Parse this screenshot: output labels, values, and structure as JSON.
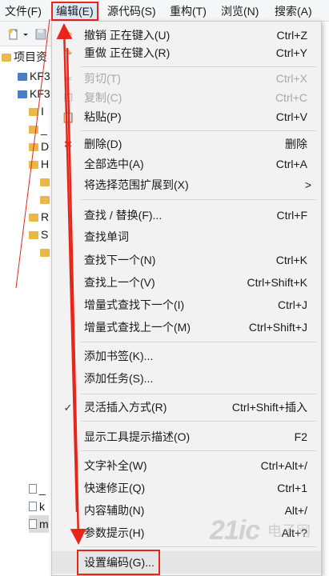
{
  "menubar": {
    "file": "文件(F)",
    "edit": "编辑(E)",
    "source": "源代码(S)",
    "refactor": "重构(T)",
    "navigate": "浏览(N)",
    "search": "搜索(A)"
  },
  "tree": {
    "header": "项目资",
    "rows": [
      "KF3",
      "KF3",
      "I",
      "_",
      "D",
      "H",
      "",
      "",
      "R",
      "S",
      "",
      "_",
      "k",
      "m"
    ]
  },
  "menu": {
    "items": [
      {
        "label": "撤销 正在键入(U)",
        "shortcut": "Ctrl+Z",
        "icon": "undo-icon"
      },
      {
        "label": "重做 正在键入(R)",
        "shortcut": "Ctrl+Y",
        "icon": "redo-icon"
      },
      {
        "label": "剪切(T)",
        "shortcut": "Ctrl+X",
        "icon": "cut-icon",
        "disabled": true
      },
      {
        "label": "复制(C)",
        "shortcut": "Ctrl+C",
        "icon": "copy-icon",
        "disabled": true
      },
      {
        "label": "粘贴(P)",
        "shortcut": "Ctrl+V",
        "icon": "paste-icon"
      },
      {
        "label": "删除(D)",
        "shortcut": "删除",
        "icon": "delete-icon"
      },
      {
        "label": "全部选中(A)",
        "shortcut": "Ctrl+A"
      },
      {
        "label": "将选择范围扩展到(X)",
        "shortcut": ">"
      },
      {
        "label": "查找 / 替换(F)...",
        "shortcut": "Ctrl+F"
      },
      {
        "label": "查找单词",
        "shortcut": ""
      },
      {
        "label": "查找下一个(N)",
        "shortcut": "Ctrl+K"
      },
      {
        "label": "查找上一个(V)",
        "shortcut": "Ctrl+Shift+K"
      },
      {
        "label": "增量式查找下一个(I)",
        "shortcut": "Ctrl+J"
      },
      {
        "label": "增量式查找上一个(M)",
        "shortcut": "Ctrl+Shift+J"
      },
      {
        "label": "添加书签(K)...",
        "shortcut": ""
      },
      {
        "label": "添加任务(S)...",
        "shortcut": ""
      },
      {
        "label": "灵活插入方式(R)",
        "shortcut": "Ctrl+Shift+插入",
        "icon": "check-icon"
      },
      {
        "label": "显示工具提示描述(O)",
        "shortcut": "F2"
      },
      {
        "label": "文字补全(W)",
        "shortcut": "Ctrl+Alt+/"
      },
      {
        "label": "快速修正(Q)",
        "shortcut": "Ctrl+1"
      },
      {
        "label": "内容辅助(N)",
        "shortcut": "Alt+/"
      },
      {
        "label": "参数提示(H)",
        "shortcut": "Alt+?"
      },
      {
        "label": "设置编码(G)...",
        "shortcut": ""
      }
    ]
  },
  "watermark": {
    "text_main": "21ic",
    "text_sub": "电子网"
  },
  "colors": {
    "accent_red": "#e8251b",
    "menu_bg": "#f2f2f2",
    "disabled": "#a8a8a8"
  }
}
